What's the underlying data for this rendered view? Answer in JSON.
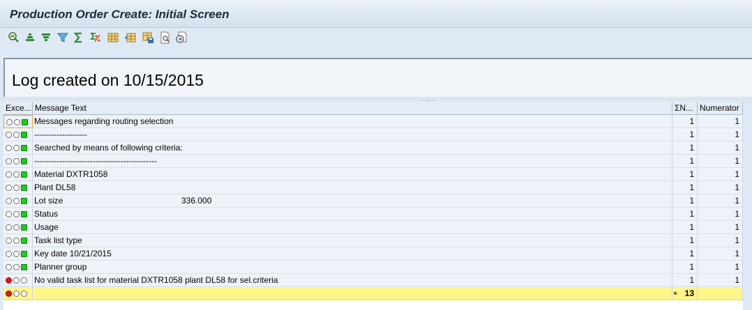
{
  "window": {
    "title": "Production Order Create: Initial Screen"
  },
  "toolbar": {
    "icons": [
      "details-icon",
      "sort-ascending-icon",
      "sort-descending-icon",
      "filter-icon",
      "sum-icon",
      "subtotal-icon",
      "layout-icon",
      "choose-layout-icon",
      "save-layout-icon",
      "print-preview-icon",
      "export-icon"
    ]
  },
  "log": {
    "header": "Log created on 10/15/2015"
  },
  "splitter": {
    "grip": "....."
  },
  "table": {
    "headers": {
      "exception": "Exce...",
      "message": "Message Text",
      "n": "ΣN...",
      "numerator": "Numerator"
    },
    "rows": [
      {
        "status": "green",
        "message": "Messages regarding routing selection",
        "n": "1",
        "numerator": "1"
      },
      {
        "status": "green",
        "message": "-------------------",
        "n": "1",
        "numerator": "1"
      },
      {
        "status": "green",
        "message": "Searched by means of following criteria:",
        "n": "1",
        "numerator": "1"
      },
      {
        "status": "green",
        "message": "--------------------------------------------",
        "n": "1",
        "numerator": "1"
      },
      {
        "status": "green",
        "message": "Material DXTR1058",
        "n": "1",
        "numerator": "1"
      },
      {
        "status": "green",
        "message": "Plant DL58",
        "n": "1",
        "numerator": "1"
      },
      {
        "status": "green",
        "message": "Lot size",
        "extra": "336.000",
        "n": "1",
        "numerator": "1"
      },
      {
        "status": "green",
        "message": "Status",
        "n": "1",
        "numerator": "1"
      },
      {
        "status": "green",
        "message": "Usage",
        "n": "1",
        "numerator": "1"
      },
      {
        "status": "green",
        "message": "Task list type",
        "n": "1",
        "numerator": "1"
      },
      {
        "status": "green",
        "message": "Key date 10/21/2015",
        "n": "1",
        "numerator": "1"
      },
      {
        "status": "green",
        "message": "Planner group",
        "n": "1",
        "numerator": "1"
      },
      {
        "status": "red",
        "message": "No valid task list for material DXTR1058 plant DL58 for sel.criteria",
        "n": "1",
        "numerator": "1"
      }
    ],
    "total": {
      "status": "red",
      "sum": "13"
    }
  },
  "colors": {
    "green": "#1ccb1c",
    "red": "#e1191c",
    "total_row": "#fff68a",
    "title_bg": "#d4e1ef"
  }
}
